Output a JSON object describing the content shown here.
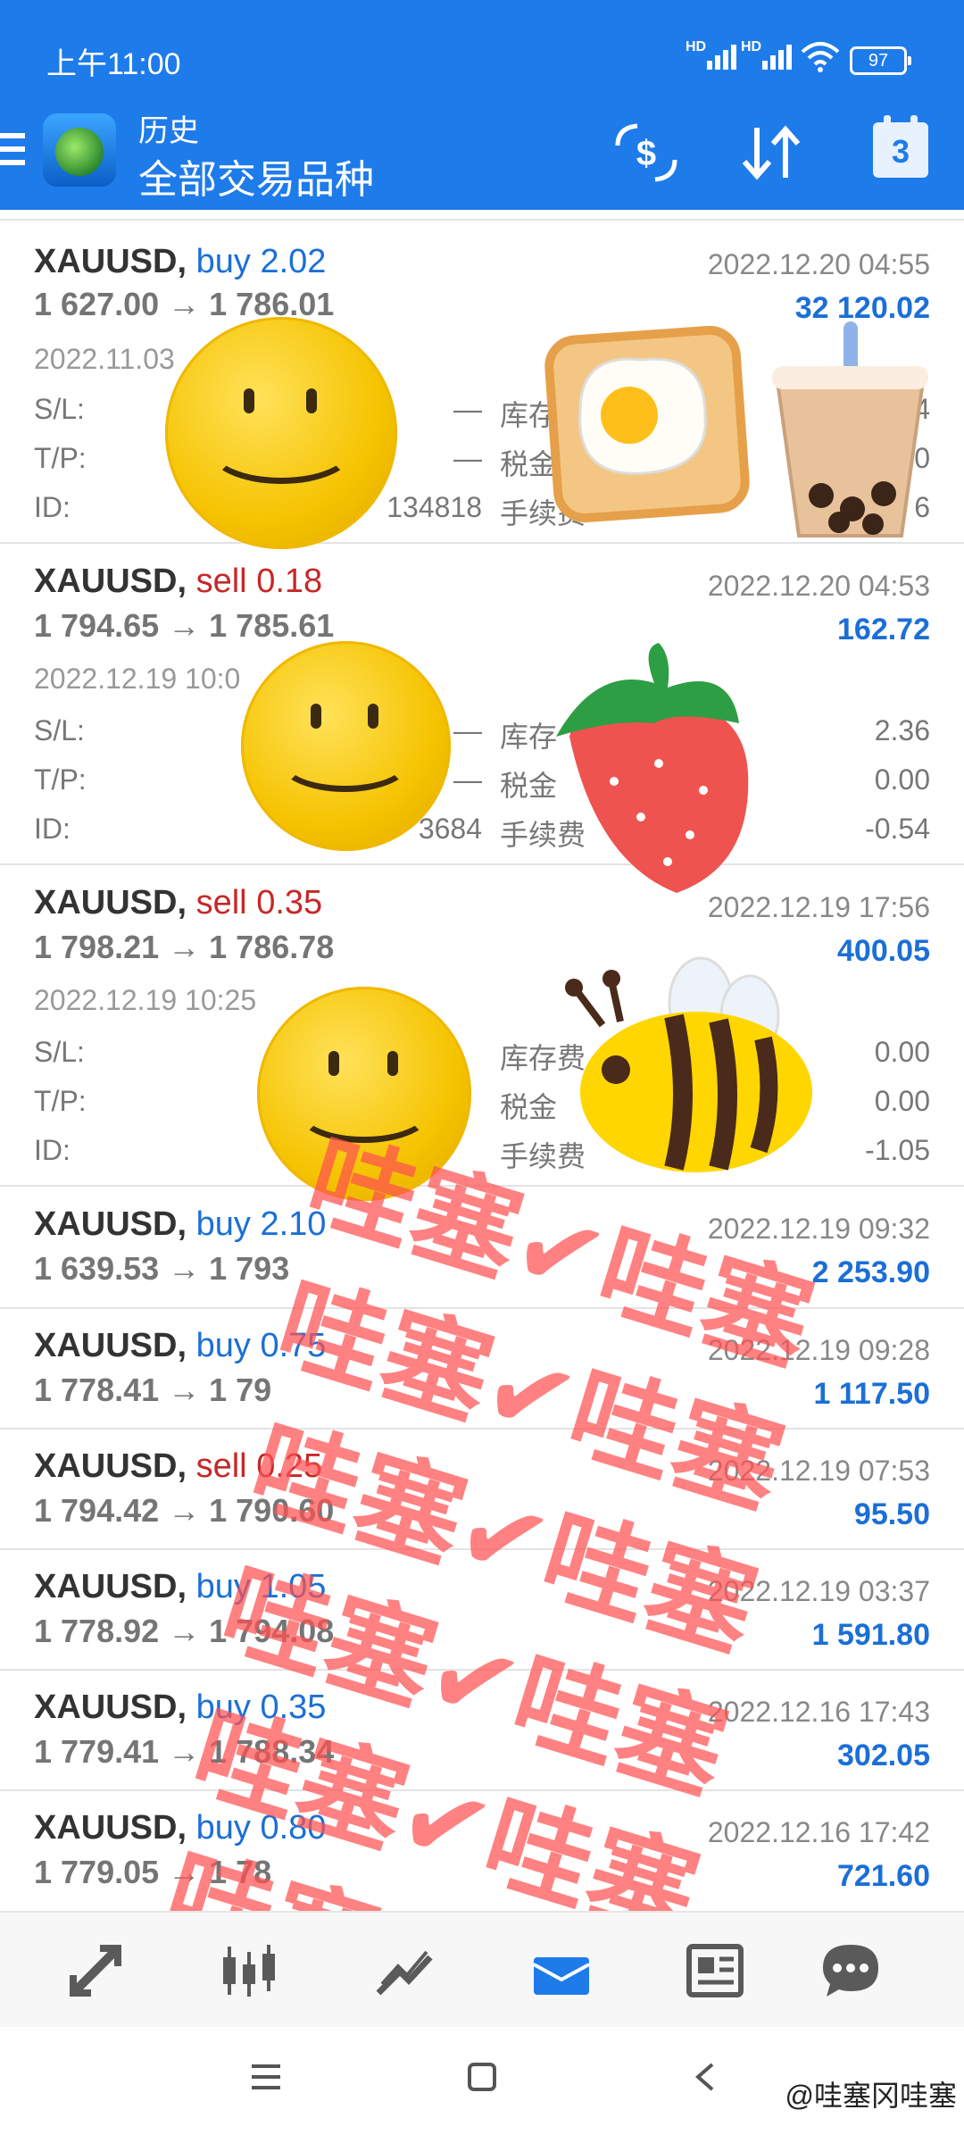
{
  "status_bar": {
    "time": "上午11:00",
    "signal1": "HD",
    "signal2": "HD",
    "battery": "97"
  },
  "header": {
    "subtitle": "历史",
    "title": "全部交易品种",
    "calendar_day": "3"
  },
  "trades": [
    {
      "symbol": "XAUUSD,",
      "side": "buy",
      "side_type": "buy",
      "volume": "2.02",
      "prices": "1 627.00 → 1 786.01",
      "close_time": "2022.12.20 04:55",
      "profit": "32 120.02",
      "expanded": true,
      "open_time": "2022.11.03",
      "sl_label": "S/L:",
      "sl_value": "—",
      "tp_label": "T/P:",
      "tp_value": "—",
      "id_label": "ID:",
      "id_value": "134818",
      "swap_label": "库存",
      "swap_value": "4",
      "tax_label": "税金",
      "tax_value": "0",
      "fee_label": "手续费",
      "fee_value": "6"
    },
    {
      "symbol": "XAUUSD,",
      "side": "sell",
      "side_type": "sell",
      "volume": "0.18",
      "prices": "1 794.65 → 1 785.61",
      "close_time": "2022.12.20 04:53",
      "profit": "162.72",
      "expanded": true,
      "open_time": "2022.12.19 10:0",
      "sl_label": "S/L:",
      "sl_value": "—",
      "tp_label": "T/P:",
      "tp_value": "—",
      "id_label": "ID:",
      "id_value": "3684",
      "swap_label": "库存",
      "swap_value": "2.36",
      "tax_label": "税金",
      "tax_value": "0.00",
      "fee_label": "手续费",
      "fee_value": "-0.54"
    },
    {
      "symbol": "XAUUSD,",
      "side": "sell",
      "side_type": "sell",
      "volume": "0.35",
      "prices": "1 798.21 → 1 786.78",
      "close_time": "2022.12.19 17:56",
      "profit": "400.05",
      "expanded": true,
      "open_time": "2022.12.19 10:25",
      "sl_label": "S/L:",
      "sl_value": "",
      "tp_label": "T/P:",
      "tp_value": "",
      "id_label": "ID:",
      "id_value": "",
      "swap_label": "库存费",
      "swap_value": "0.00",
      "tax_label": "税金",
      "tax_value": "0.00",
      "fee_label": "手续费",
      "fee_value": "-1.05"
    },
    {
      "symbol": "XAUUSD,",
      "side": "buy",
      "side_type": "buy",
      "volume": "2.10",
      "prices": "1 639.53 → 1 793",
      "close_time": "2022.12.19 09:32",
      "profit": "2 253.90",
      "expanded": false
    },
    {
      "symbol": "XAUUSD,",
      "side": "buy",
      "side_type": "buy",
      "volume": "0.75",
      "prices": "1 778.41 → 1 79",
      "close_time": "2022.12.19 09:28",
      "profit": "1 117.50",
      "expanded": false
    },
    {
      "symbol": "XAUUSD,",
      "side": "sell",
      "side_type": "sell",
      "volume": "0.25",
      "prices": "1 794.42 → 1 790.60",
      "close_time": "2022.12.19 07:53",
      "profit": "95.50",
      "expanded": false
    },
    {
      "symbol": "XAUUSD,",
      "side": "buy",
      "side_type": "buy",
      "volume": "1.05",
      "prices": "1 778.92 → 1 794.08",
      "close_time": "2022.12.19 03:37",
      "profit": "1 591.80",
      "expanded": false
    },
    {
      "symbol": "XAUUSD,",
      "side": "buy",
      "side_type": "buy",
      "volume": "0.35",
      "prices": "1 779.41 → 1 788.34",
      "close_time": "2022.12.16 17:43",
      "profit": "302.05",
      "expanded": false
    },
    {
      "symbol": "XAUUSD,",
      "side": "buy",
      "side_type": "buy",
      "volume": "0.80",
      "prices": "1 779.05 → 1 78",
      "close_time": "2022.12.16 17:42",
      "profit": "721.60",
      "expanded": false
    }
  ],
  "watermark_stamp": "哇塞✔哇塞",
  "watermark_credit": "@哇塞冈哇塞",
  "bottom_nav": [
    "trade-icon",
    "quotes-chart-icon",
    "chart-icon",
    "history-icon",
    "news-icon",
    "chat-icon"
  ],
  "colors": {
    "accent": "#1e7bea",
    "buy": "#1b6fd6",
    "sell": "#c62828"
  }
}
